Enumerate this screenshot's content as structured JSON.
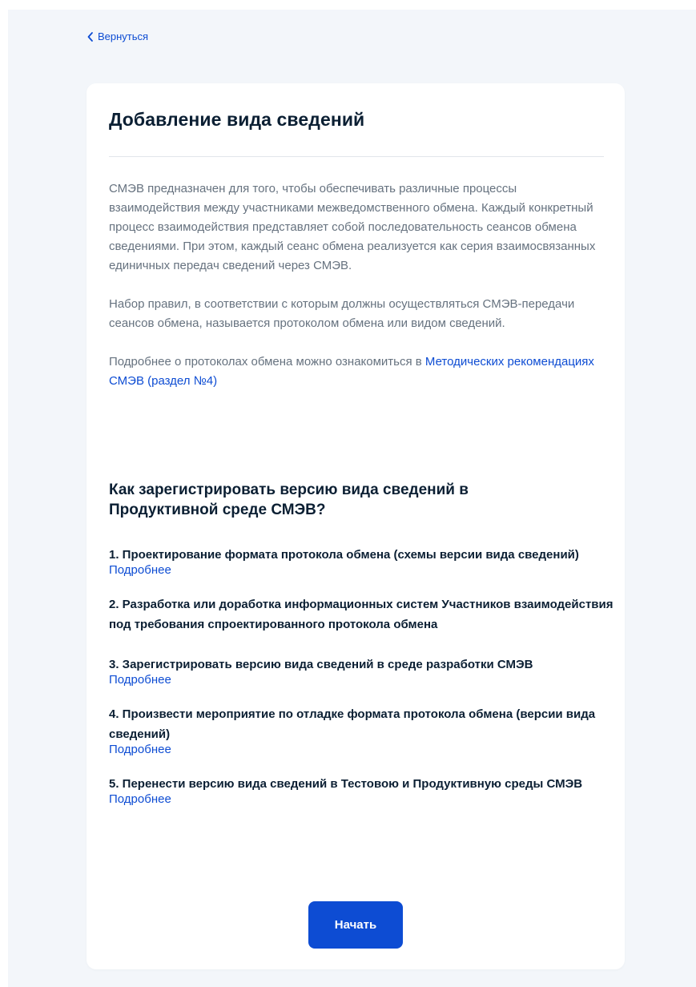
{
  "nav": {
    "back_label": "Вернуться"
  },
  "card": {
    "title": "Добавление вида сведений",
    "intro_paragraphs": [
      "СМЭВ предназначен для того, чтобы обеспечивать различные процессы взаимодействия между участниками межведомственного обмена. Каждый конкретный процесс взаимодействия представляет собой последовательность сеансов обмена сведениями. При этом, каждый сеанс обмена реализуется как серия взаимосвязанных единичных передач сведений через СМЭВ.",
      "Набор правил, в соответствии с которым должны осуществляться СМЭВ-передачи сеансов обмена, называется протоколом обмена или видом сведений."
    ],
    "more_info": {
      "text": "Подробнее о протоколах обмена можно ознакомиться в ",
      "link_label": "Методических рекомендациях СМЭВ (раздел №4)"
    },
    "section_title": "Как зарегистрировать версию вида сведений в Продуктивной среде СМЭВ?",
    "steps": [
      {
        "title": "1. Проектирование формата протокола обмена (схемы версии вида сведений)",
        "link": "Подробнее"
      },
      {
        "title": "2. Разработка или доработка информационных систем Участников взаимодействия под требования спроектированного протокола обмена",
        "link": ""
      },
      {
        "title": "3. Зарегистрировать версию вида сведений в среде разработки СМЭВ",
        "link": "Подробнее"
      },
      {
        "title": "4. Произвести мероприятие по отладке формата протокола обмена (версии вида сведений)",
        "link": "Подробнее"
      },
      {
        "title": "5. Перенести версию вида сведений в Тестовою и Продуктивную среды СМЭВ",
        "link": "Подробнее"
      }
    ],
    "start_button_label": "Начать"
  },
  "colors": {
    "accent": "#0d4cd3",
    "heading": "#0b1f33",
    "body_text": "#66727f",
    "page_background": "#f3f6fa",
    "card_background": "#ffffff"
  },
  "icons": {
    "back": "chevron-left-icon"
  }
}
